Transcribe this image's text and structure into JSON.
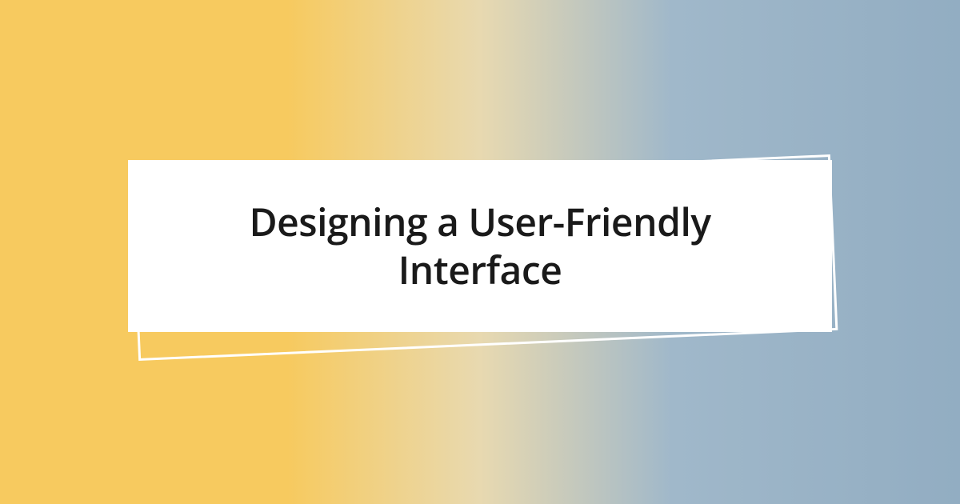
{
  "card": {
    "title": "Designing a User-Friendly Interface"
  },
  "colors": {
    "gradient_start": "#f7ca5f",
    "gradient_end": "#92adc2",
    "card_bg": "#ffffff",
    "text": "#1a1a1a"
  }
}
